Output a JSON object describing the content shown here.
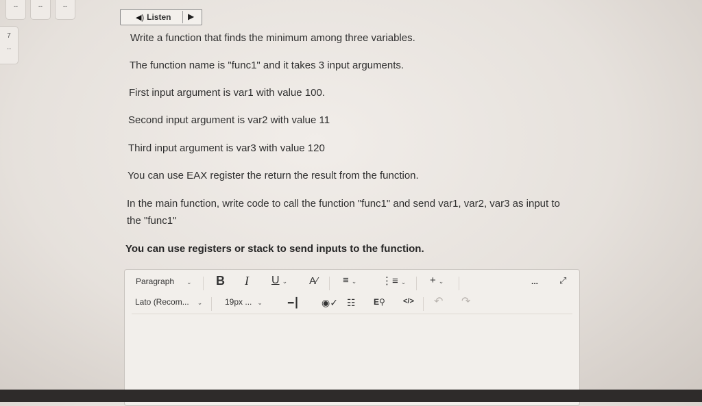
{
  "nav": {
    "boxes": [
      "--",
      "--",
      "--"
    ],
    "question_number": "7",
    "question_marker": "--"
  },
  "listen": {
    "label": "Listen"
  },
  "question": {
    "lines": [
      "Write a function that finds the  minimum among three variables.",
      "The function name is \"func1\" and it takes 3 input arguments.",
      "First input argument is var1 with value 100.",
      "Second input argument is var2 with value 11",
      "Third input argument is var3 with value 120",
      "You can use EAX register the return the result from the function.",
      "In the main function, write code to call the function \"func1\" and send var1, var2, var3 as input to the \"func1\"",
      "You can use registers or stack to send inputs to the function."
    ]
  },
  "editor": {
    "block_format": "Paragraph",
    "font_family": "Lato (Recom...",
    "font_size": "19px ...",
    "bold": "B",
    "italic": "I",
    "underline": "U",
    "more": "...",
    "source_code": "</>"
  },
  "icons": {
    "speaker": "speaker-icon",
    "play": "play-icon",
    "text-color": "text-color-icon",
    "align": "align-icon",
    "list": "list-icon",
    "insert": "plus-icon",
    "fullscreen": "fullscreen-icon",
    "format-painter": "format-painter-icon",
    "accessibility": "accessibility-icon",
    "table": "table-icon",
    "find-replace": "find-replace-icon",
    "undo": "undo-icon",
    "redo": "redo-icon"
  }
}
